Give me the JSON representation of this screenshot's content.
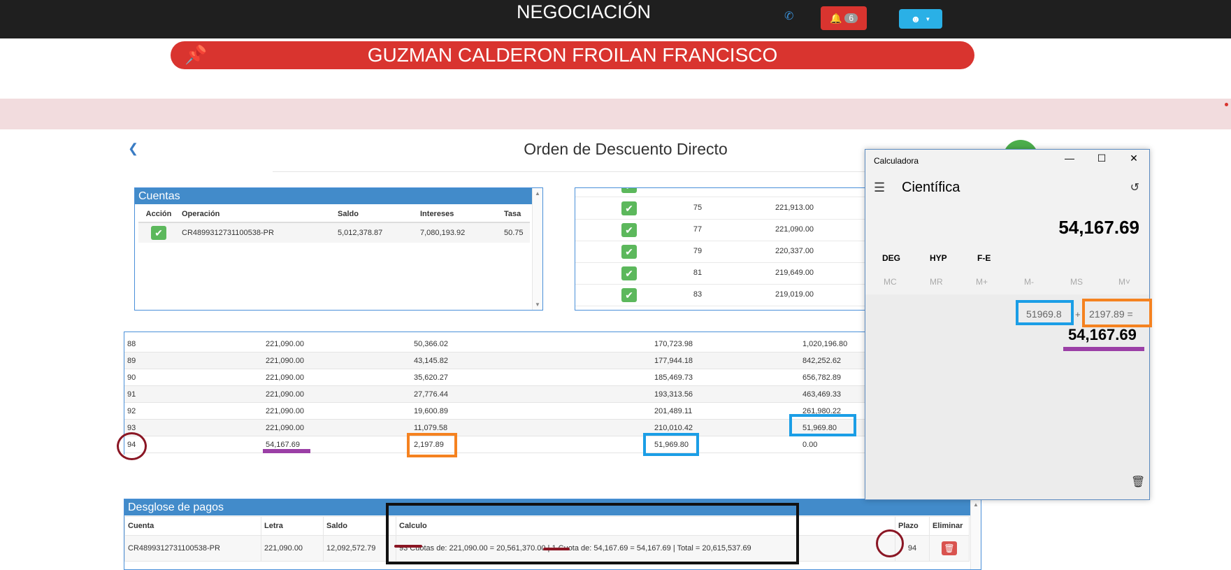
{
  "app_title": "NEGOCIACIÓN",
  "header": {
    "notifications_count": "6",
    "phone_icon": "phone-icon",
    "bell_icon": "bell-icon",
    "user_icon": "user-icon"
  },
  "banner": {
    "client_name": "GUZMAN CALDERON FROILAN FRANCISCO",
    "color": "#d9342f"
  },
  "page": {
    "title": "Orden de Descuento Directo"
  },
  "cuentas": {
    "title": "Cuentas",
    "headers": [
      "Acción",
      "Operación",
      "Saldo",
      "Intereses",
      "Tasa"
    ],
    "rows": [
      {
        "operacion": "CR4899312731100538-PR",
        "saldo": "5,012,378.87",
        "intereses": "7,080,193.92",
        "tasa": "50.75"
      }
    ]
  },
  "checks_list": [
    {
      "num": "75",
      "value": "221,913.00"
    },
    {
      "num": "77",
      "value": "221,090.00"
    },
    {
      "num": "79",
      "value": "220,337.00"
    },
    {
      "num": "81",
      "value": "219,649.00"
    },
    {
      "num": "83",
      "value": "219,019.00"
    }
  ],
  "amortization": [
    {
      "n": "88",
      "cuota": "221,090.00",
      "interes": "50,366.02",
      "capital": "170,723.98",
      "saldo": "1,020,196.80"
    },
    {
      "n": "89",
      "cuota": "221,090.00",
      "interes": "43,145.82",
      "capital": "177,944.18",
      "saldo": "842,252.62"
    },
    {
      "n": "90",
      "cuota": "221,090.00",
      "interes": "35,620.27",
      "capital": "185,469.73",
      "saldo": "656,782.89"
    },
    {
      "n": "91",
      "cuota": "221,090.00",
      "interes": "27,776.44",
      "capital": "193,313.56",
      "saldo": "463,469.33"
    },
    {
      "n": "92",
      "cuota": "221,090.00",
      "interes": "19,600.89",
      "capital": "201,489.11",
      "saldo": "261,980.22"
    },
    {
      "n": "93",
      "cuota": "221,090.00",
      "interes": "11,079.58",
      "capital": "210,010.42",
      "saldo": "51,969.80"
    },
    {
      "n": "94",
      "cuota": "54,167.69",
      "interes": "2,197.89",
      "capital": "51,969.80",
      "saldo": "0.00"
    }
  ],
  "desglose": {
    "title": "Desglose de pagos",
    "headers": [
      "Cuenta",
      "Letra",
      "Saldo",
      "Calculo",
      "Plazo",
      "Eliminar"
    ],
    "row": {
      "cuenta": "CR4899312731100538-PR",
      "letra": "221,090.00",
      "saldo": "12,092,572.79",
      "calculo": "93 Cuotas de: 221,090.00 = 20,561,370.00 | 1 Cuota de: 54,167.69 = 54,167.69 | Total = 20,615,537.69",
      "plazo": "94"
    }
  },
  "calculator": {
    "window_title": "Calculadora",
    "mode": "Científica",
    "display": "54,167.69",
    "options": [
      "DEG",
      "HYP",
      "F-E"
    ],
    "memory": [
      "MC",
      "MR",
      "M+",
      "M-",
      "MS",
      "M˅"
    ],
    "expr_a": "51969.8",
    "plus": "+",
    "expr_b": "2197.89 =",
    "result": "54,167.69"
  },
  "annotation_colors": {
    "orange": "#f58220",
    "blue": "#1b9ee6",
    "purple": "#9b3fa6",
    "dark_red": "#8a1624",
    "black": "#111111"
  }
}
